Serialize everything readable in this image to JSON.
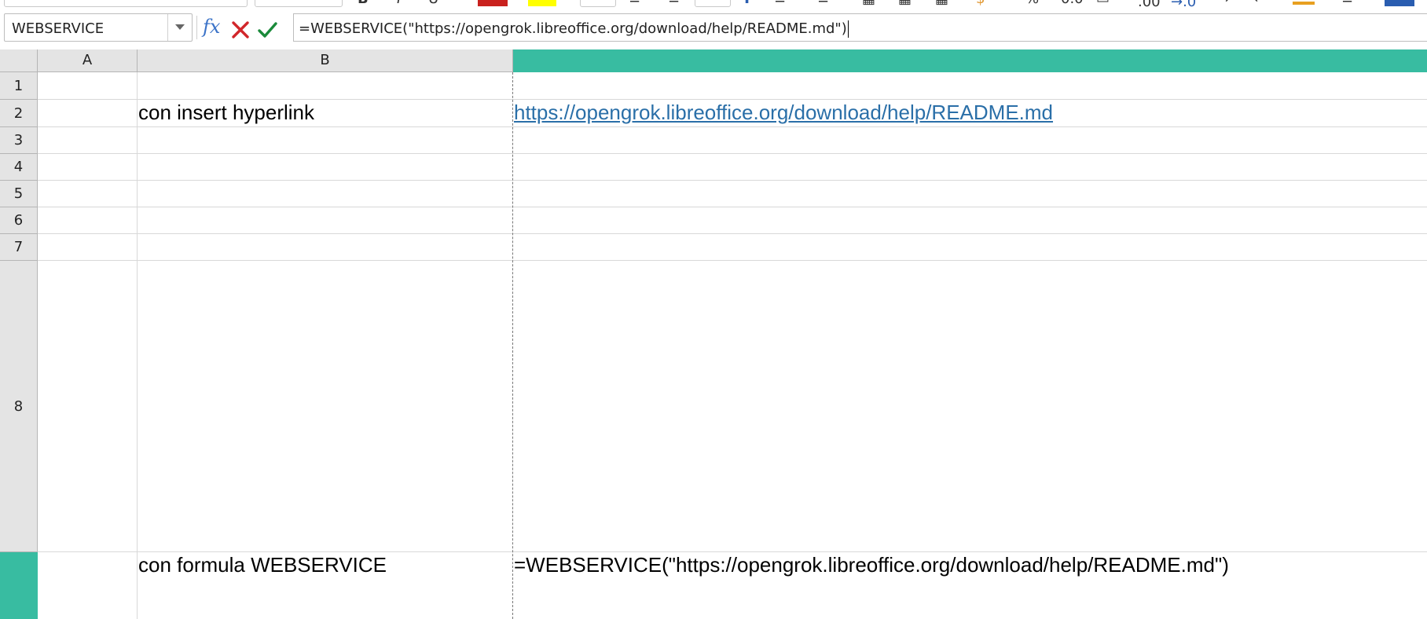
{
  "toolbar": {
    "colors": {
      "font_color": "#c9211e",
      "highlight_color": "#ffff00",
      "accent": "#38bca1"
    }
  },
  "formula_bar": {
    "name_box": "WEBSERVICE",
    "fx_label": "fx",
    "formula": "=WEBSERVICE(\"https://opengrok.libreoffice.org/download/help/README.md\")"
  },
  "sheet": {
    "columns": [
      "A",
      "B",
      ""
    ],
    "rows": [
      "1",
      "2",
      "3",
      "4",
      "5",
      "6",
      "7",
      "8",
      ""
    ],
    "cells": {
      "B2": "con insert hyperlink",
      "C2": "https://opengrok.libreoffice.org/download/help/README.md",
      "B9": "con formula WEBSERVICE",
      "C9": "=WEBSERVICE(\"https://opengrok.libreoffice.org/download/help/README.md\")"
    }
  }
}
